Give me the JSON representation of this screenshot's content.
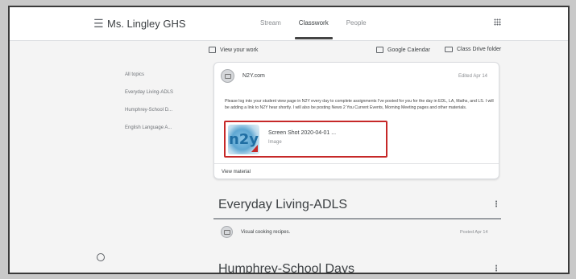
{
  "header": {
    "class_name": "Ms. Lingley GHS",
    "tabs": [
      {
        "label": "Stream",
        "active": false
      },
      {
        "label": "Classwork",
        "active": true
      },
      {
        "label": "People",
        "active": false
      }
    ]
  },
  "sidebar": {
    "items": [
      {
        "label": "All topics"
      },
      {
        "label": "Everyday Living-ADLS"
      },
      {
        "label": "Humphrey-School D..."
      },
      {
        "label": "English Language A..."
      }
    ]
  },
  "toolbar": {
    "view_work": "View your work",
    "calendar": "Google Calendar",
    "drive": "Class Drive folder"
  },
  "material": {
    "title": "N2Y.com",
    "edited": "Edited Apr 14",
    "body": "Please log into your student view page in N2Y every day to complete assignments I've posted for you for the day in EDL, LA, Maths, and LS. I will be adding a link to N2Y hear shortly. I will also be posting News 2 You Current Events, Morning Meeting pages and other materials.",
    "attachment": {
      "thumb_label": "n2y",
      "name": "Screen Shot 2020-04-01 ...",
      "type": "Image"
    },
    "view_label": "View material"
  },
  "topics": [
    {
      "heading": "Everyday Living-ADLS",
      "items": [
        {
          "title": "Visual cooking recipes.",
          "posted": "Posted Apr 14"
        }
      ]
    },
    {
      "heading": "Humphrey-School Days",
      "items": []
    }
  ],
  "colors": {
    "highlight_border": "#c62828",
    "card_bg": "#ffffff",
    "page_bg": "#f4f4f4"
  }
}
